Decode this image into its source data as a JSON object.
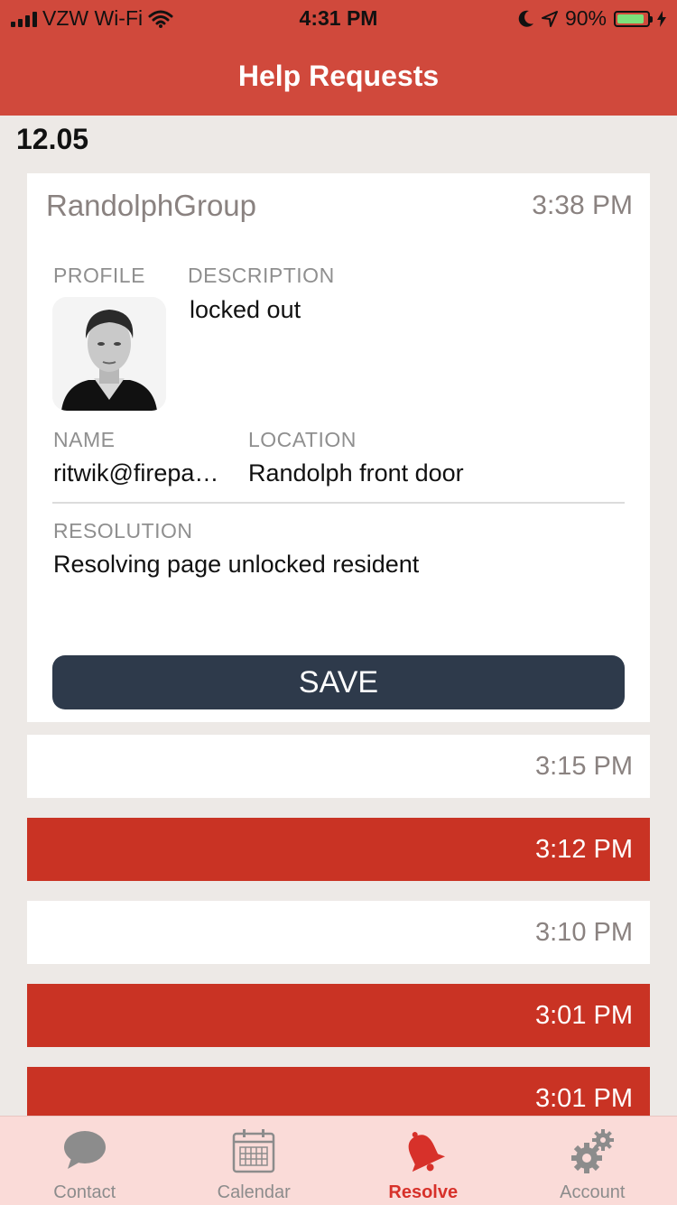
{
  "status_bar": {
    "carrier": "VZW Wi-Fi",
    "time": "4:31 PM",
    "battery_percent": "90%",
    "battery_level": 0.9
  },
  "header": {
    "title": "Help Requests"
  },
  "date_section": "12.05",
  "expanded_request": {
    "organization": "RandolphGroup",
    "time": "3:38 PM",
    "profile_label": "PROFILE",
    "description_label": "DESCRIPTION",
    "description": "locked out",
    "name_label": "NAME",
    "name": "ritwik@firepa…",
    "location_label": "LOCATION",
    "location": "Randolph front door",
    "resolution_label": "RESOLUTION",
    "resolution": "Resolving page unlocked resident",
    "save_label": "SAVE"
  },
  "requests": [
    {
      "time": "3:15 PM",
      "style": "white"
    },
    {
      "time": "3:12 PM",
      "style": "red"
    },
    {
      "time": "3:10 PM",
      "style": "white"
    },
    {
      "time": "3:01 PM",
      "style": "red"
    },
    {
      "time": "3:01 PM",
      "style": "red"
    }
  ],
  "tabs": [
    {
      "label": "Contact",
      "icon": "chat-bubble-icon"
    },
    {
      "label": "Calendar",
      "icon": "calendar-icon"
    },
    {
      "label": "Resolve",
      "icon": "bell-icon",
      "active": true
    },
    {
      "label": "Account",
      "icon": "gear-icon"
    }
  ],
  "colors": {
    "header": "#d0493c",
    "accent_red": "#c93324",
    "save_button": "#2e3a4b",
    "tab_active": "#d7312a",
    "tabbar": "#fadbd8"
  }
}
